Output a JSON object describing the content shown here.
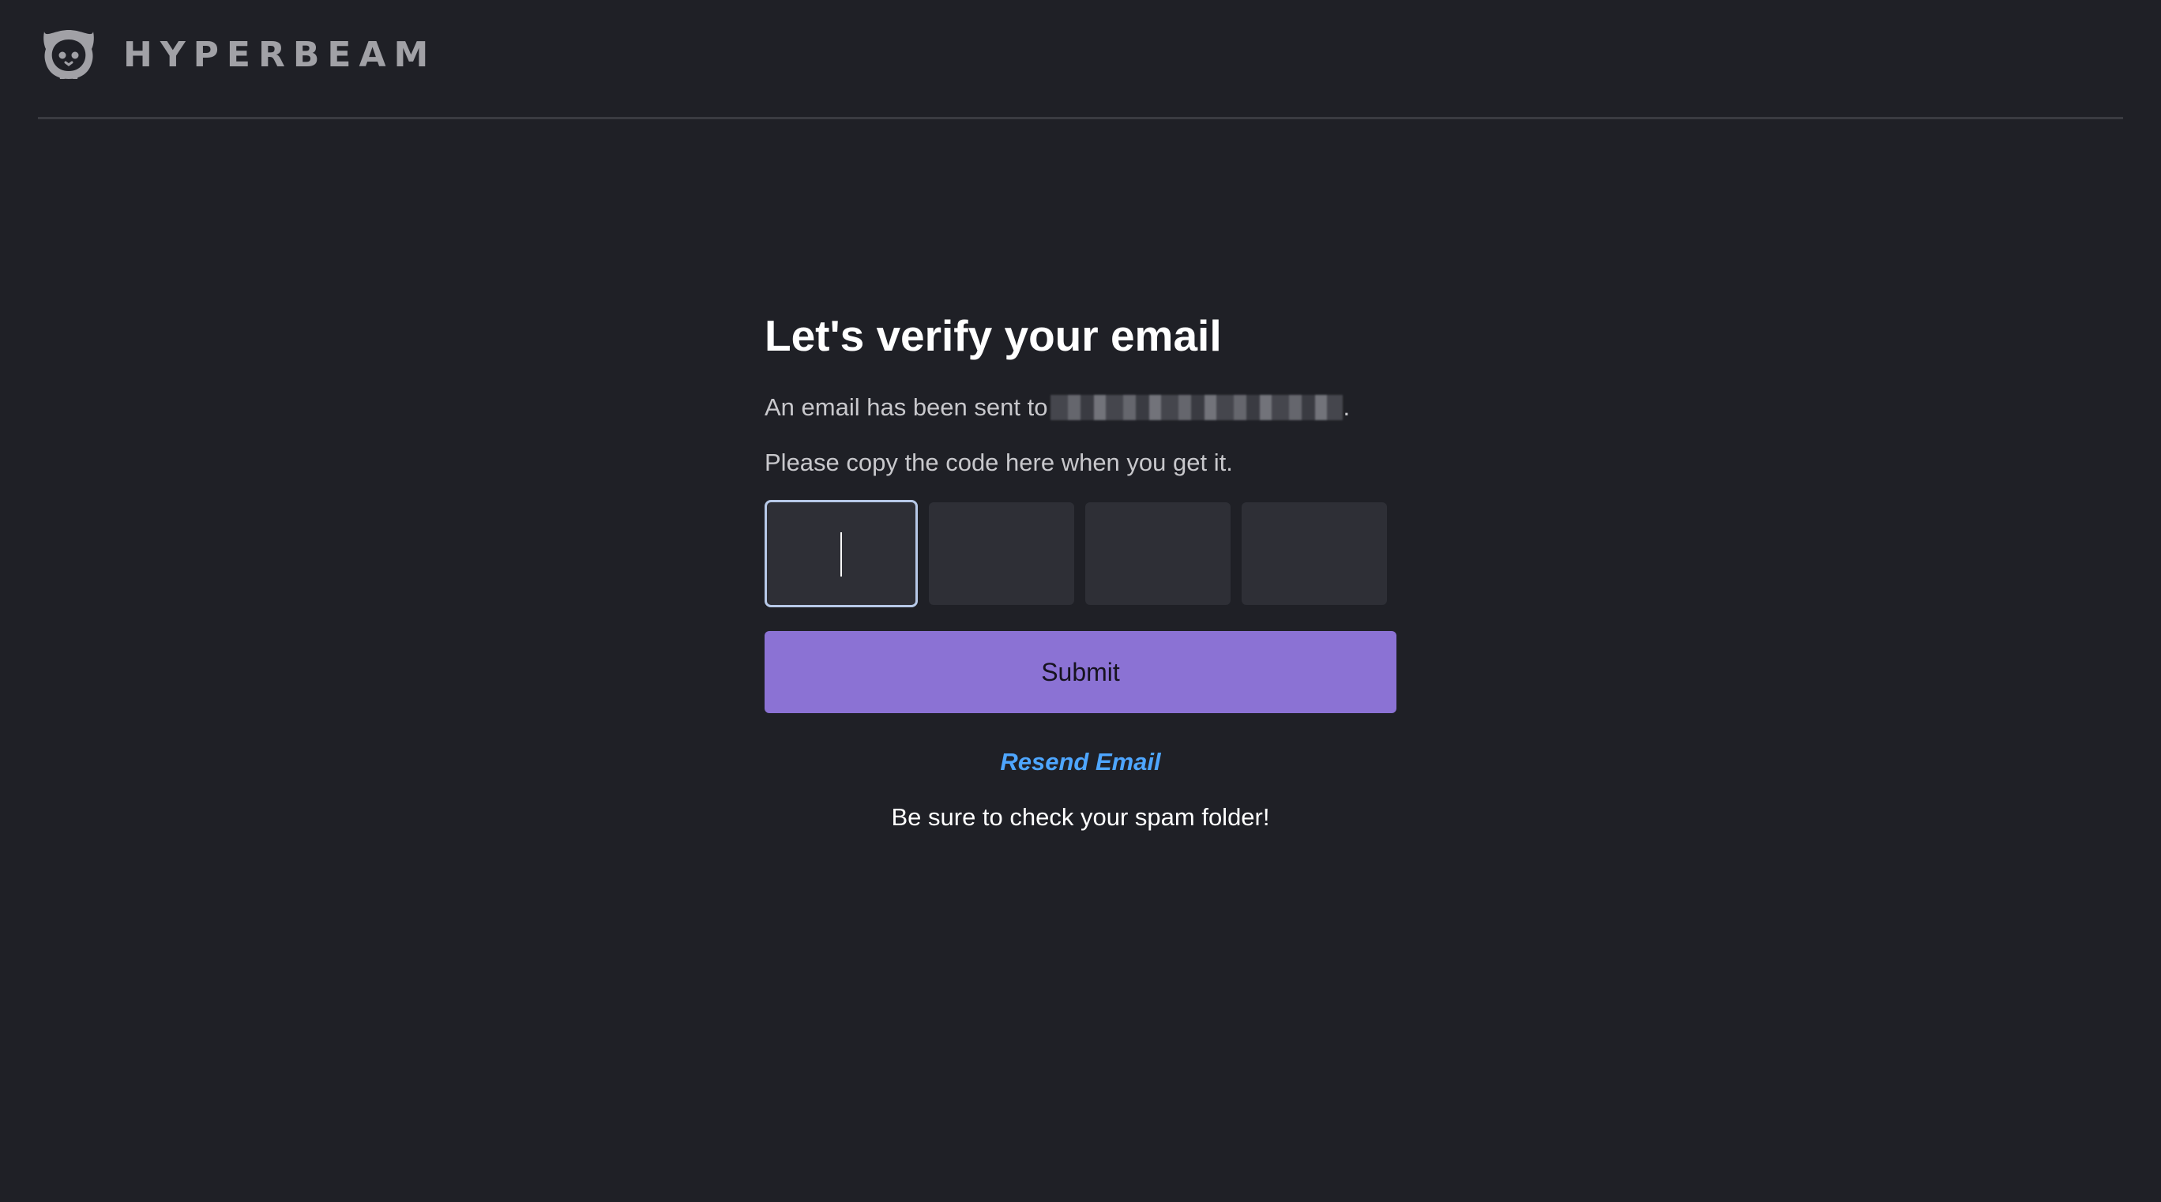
{
  "header": {
    "logo_icon": "cat-face-icon",
    "brand": "HYPERBEAM"
  },
  "verify": {
    "title": "Let's verify your email",
    "sent_prefix": "An email has been sent to",
    "sent_suffix": ".",
    "instruction": "Please copy the code here when you get it.",
    "code_fields": [
      "",
      "",
      "",
      ""
    ],
    "submit_label": "Submit",
    "resend_label": "Resend Email",
    "spam_hint": "Be sure to check your spam folder!"
  },
  "colors": {
    "background": "#1f2026",
    "accent": "#8b72d4",
    "link": "#4ea6ff",
    "input_bg": "#2e2f36",
    "focus_border": "#b7c9e8"
  }
}
